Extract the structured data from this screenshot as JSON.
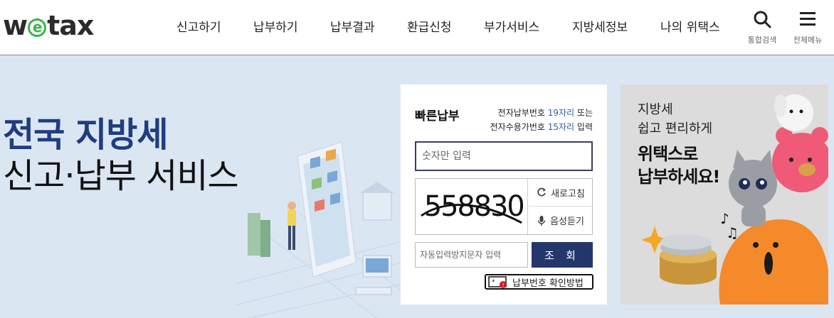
{
  "header": {
    "logo_text_1": "w",
    "logo_e": "e",
    "logo_text_2": "tax",
    "nav": [
      "신고하기",
      "납부하기",
      "납부결과",
      "환급신청",
      "부가서비스",
      "지방세정보",
      "나의 위택스"
    ],
    "search_label": "통합검색",
    "menu_label": "전체메뉴"
  },
  "hero": {
    "line1": "전국 지방세",
    "line2": "신고·납부 서비스"
  },
  "quick_pay": {
    "title": "빠른납부",
    "desc_line1_prefix": "전자납부번호 ",
    "desc_line1_hl": "19자리",
    "desc_line1_suffix": " 또는",
    "desc_line2_prefix": "전자수용가번호 ",
    "desc_line2_hl": "15자리",
    "desc_line2_suffix": " 입력",
    "number_placeholder": "숫자만 입력",
    "captcha_text": "558830",
    "refresh_label": "새로고침",
    "audio_label": "음성듣기",
    "auto_placeholder": "자동입력방지문자 입력",
    "search_button": "조 회",
    "howto_label": "납부번호 확인방법"
  },
  "promo": {
    "line1": "지방세",
    "line2": "쉽고 편리하게",
    "line3": "위택스로",
    "line4": "납부하세요!"
  },
  "colors": {
    "accent": "#1f3d80",
    "button": "#24376b",
    "highlight": "#2f5ea8",
    "logo_green": "#39b54a",
    "background": "#dbe6f3"
  }
}
